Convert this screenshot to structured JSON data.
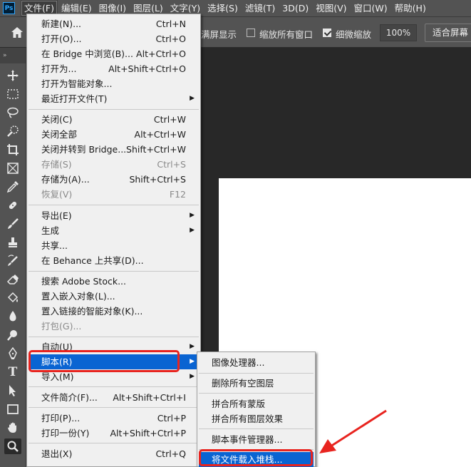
{
  "app": {
    "logo": "Ps"
  },
  "menubar": {
    "items": [
      "文件(F)",
      "编辑(E)",
      "图像(I)",
      "图层(L)",
      "文字(Y)",
      "选择(S)",
      "滤镜(T)",
      "3D(D)",
      "视图(V)",
      "窗口(W)",
      "帮助(H)"
    ],
    "active": "文件(F)"
  },
  "options_bar": {
    "fullscreen_label": "满屏显示",
    "zoom_all_label": "缩放所有窗口",
    "zoom_all_checked": false,
    "scrubby_label": "细微缩放",
    "scrubby_checked": true,
    "zoom_value": "100%",
    "fit_screen_label": "适合屏幕"
  },
  "toolbar": {
    "header": "»",
    "tools": [
      "move-tool",
      "marquee-tool",
      "lasso-tool",
      "quick-select-tool",
      "crop-tool",
      "frame-tool",
      "eyedropper-tool",
      "healing-brush-tool",
      "brush-tool",
      "clone-stamp-tool",
      "history-brush-tool",
      "eraser-tool",
      "paint-bucket-tool",
      "blur-tool",
      "dodge-tool",
      "pen-tool",
      "type-tool",
      "path-select-tool",
      "rectangle-tool",
      "hand-tool",
      "zoom-tool"
    ],
    "selected": "zoom-tool"
  },
  "file_menu": {
    "items": [
      {
        "label": "新建(N)...",
        "shortcut": "Ctrl+N"
      },
      {
        "label": "打开(O)...",
        "shortcut": "Ctrl+O"
      },
      {
        "label": "在 Bridge 中浏览(B)...",
        "shortcut": "Alt+Ctrl+O"
      },
      {
        "label": "打开为...",
        "shortcut": "Alt+Shift+Ctrl+O"
      },
      {
        "label": "打开为智能对象...",
        "shortcut": ""
      },
      {
        "label": "最近打开文件(T)",
        "shortcut": "",
        "submenu": true
      },
      {
        "label": "关闭(C)",
        "shortcut": "Ctrl+W"
      },
      {
        "label": "关闭全部",
        "shortcut": "Alt+Ctrl+W"
      },
      {
        "label": "关闭并转到 Bridge...",
        "shortcut": "Shift+Ctrl+W"
      },
      {
        "label": "存储(S)",
        "shortcut": "Ctrl+S",
        "disabled": true
      },
      {
        "label": "存储为(A)...",
        "shortcut": "Shift+Ctrl+S"
      },
      {
        "label": "恢复(V)",
        "shortcut": "F12",
        "disabled": true
      },
      {
        "label": "导出(E)",
        "shortcut": "",
        "submenu": true
      },
      {
        "label": "生成",
        "shortcut": "",
        "submenu": true
      },
      {
        "label": "共享...",
        "shortcut": ""
      },
      {
        "label": "在 Behance 上共享(D)...",
        "shortcut": ""
      },
      {
        "label": "搜索 Adobe Stock...",
        "shortcut": ""
      },
      {
        "label": "置入嵌入对象(L)...",
        "shortcut": ""
      },
      {
        "label": "置入链接的智能对象(K)...",
        "shortcut": ""
      },
      {
        "label": "打包(G)...",
        "shortcut": "",
        "disabled": true
      },
      {
        "label": "自动(U)",
        "shortcut": "",
        "submenu": true
      },
      {
        "label": "脚本(R)",
        "shortcut": "",
        "submenu": true,
        "highlighted": true
      },
      {
        "label": "导入(M)",
        "shortcut": "",
        "submenu": true
      },
      {
        "label": "文件简介(F)...",
        "shortcut": "Alt+Shift+Ctrl+I"
      },
      {
        "label": "打印(P)...",
        "shortcut": "Ctrl+P"
      },
      {
        "label": "打印一份(Y)",
        "shortcut": "Alt+Shift+Ctrl+P"
      },
      {
        "label": "退出(X)",
        "shortcut": "Ctrl+Q"
      }
    ]
  },
  "script_menu": {
    "items": [
      {
        "label": "图像处理器..."
      },
      {
        "label": "删除所有空图层"
      },
      {
        "label": "拼合所有蒙版"
      },
      {
        "label": "拼合所有图层效果"
      },
      {
        "label": "脚本事件管理器..."
      },
      {
        "label": "将文件载入堆栈...",
        "highlighted": true
      }
    ]
  },
  "colors": {
    "highlight": "#0a64d2",
    "annotation": "#e8241f"
  }
}
